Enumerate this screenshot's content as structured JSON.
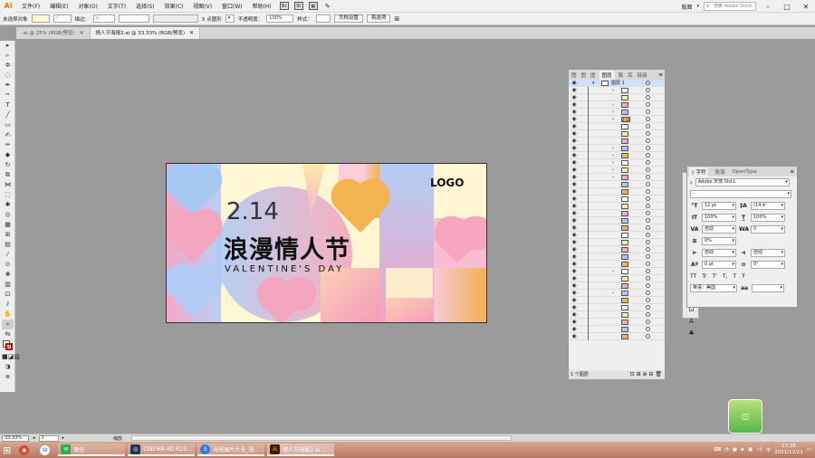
{
  "app": {
    "logo": "Ai"
  },
  "menus": [
    "文件(F)",
    "编辑(E)",
    "对象(O)",
    "文字(T)",
    "选择(S)",
    "效果(C)",
    "视图(V)",
    "窗口(W)",
    "帮助(H)"
  ],
  "topbar_icons": [
    "Br",
    "St"
  ],
  "workspace": "版面",
  "stock_search": {
    "placeholder": "搜索 Adobe Stock"
  },
  "control": {
    "selection": "未选择对象",
    "stroke_label": "描边：",
    "point_label": "5 点圆形",
    "opacity_label": "不透明度：",
    "opacity_value": "100%",
    "style_label": "样式：",
    "doc_setup": "文档设置",
    "prefs": "首选项"
  },
  "tabs": [
    {
      "label": ".ai @ 25% (RGB/预览)"
    },
    {
      "label": "情人节海报2.ai @ 33.33% (RGB/预览)"
    }
  ],
  "poster": {
    "date": "2.14",
    "title": "浪漫情人节",
    "subtitle": "VALENTINE'S DAY",
    "logo": "LOGO"
  },
  "layers": {
    "tabs": [
      "图",
      "图",
      "图",
      "图层",
      "路",
      "库",
      "链接"
    ],
    "top_layer": "图层 1",
    "row_label": "2.14",
    "footer": "1 个图层"
  },
  "character": {
    "tabs": [
      "字符",
      "段落",
      "OpenType"
    ],
    "font_family": "Adobe 宋体 Std L",
    "font_style": "-",
    "size": "12 pt",
    "leading": "(14.4",
    "h_scale": "100%",
    "v_scale": "100%",
    "kerning": "自动",
    "tracking": "0",
    "tsume": "0%",
    "aki_left": "自动",
    "aki_right": "自动",
    "baseline": "0 pt",
    "rotation": "0°",
    "tt": [
      "TT",
      "Tr",
      "T'",
      "T,",
      "T",
      "Ŧ"
    ],
    "language": "英语：美国",
    "aa": "aa"
  },
  "status": {
    "zoom": "33.33%",
    "page": "1",
    "tool": "缩放"
  },
  "taskbar": {
    "items": [
      "微信",
      "CINEMA 4D R19...",
      "海报图片大全_海...",
      "情人节海报2.ai ..."
    ],
    "time": "13:38",
    "date": "2021/12/21"
  },
  "colors": {
    "accent": "#e67a00",
    "pink": "#f4a6c0",
    "blue": "#a8c8f4",
    "yellow": "#fde8a6",
    "orange": "#f3b34f"
  }
}
